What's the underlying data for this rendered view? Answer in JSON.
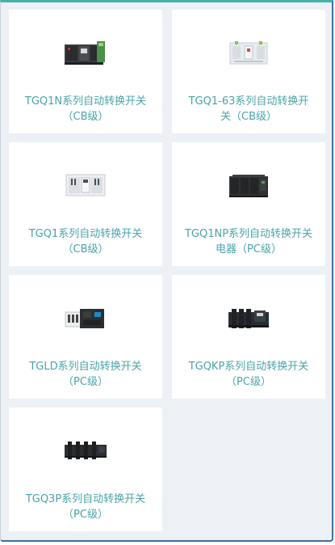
{
  "products": [
    {
      "title": "TGQ1N系列自动转换开关\n（CB级）",
      "icon": "tgq1n-switch-image"
    },
    {
      "title": "TGQ1-63系列自动转换开\n关（CB级）",
      "icon": "tgq1-63-switch-image"
    },
    {
      "title": "TGQ1系列自动转换开关\n（CB级）",
      "icon": "tgq1-switch-image"
    },
    {
      "title": "TGQ1NP系列自动转换开关\n电器（PC级）",
      "icon": "tgq1np-switch-image"
    },
    {
      "title": "TGLD系列自动转换开关\n（PC级）",
      "icon": "tgld-switch-image"
    },
    {
      "title": "TGQKP系列自动转换开关\n（PC级）",
      "icon": "tgqkp-switch-image"
    },
    {
      "title": "TGQ3P系列自动转换开关\n（PC级）",
      "icon": "tgq3p-switch-image"
    }
  ],
  "colors": {
    "title_text": "#4aa3a8",
    "background": "#edf0f4",
    "card": "#ffffff"
  }
}
